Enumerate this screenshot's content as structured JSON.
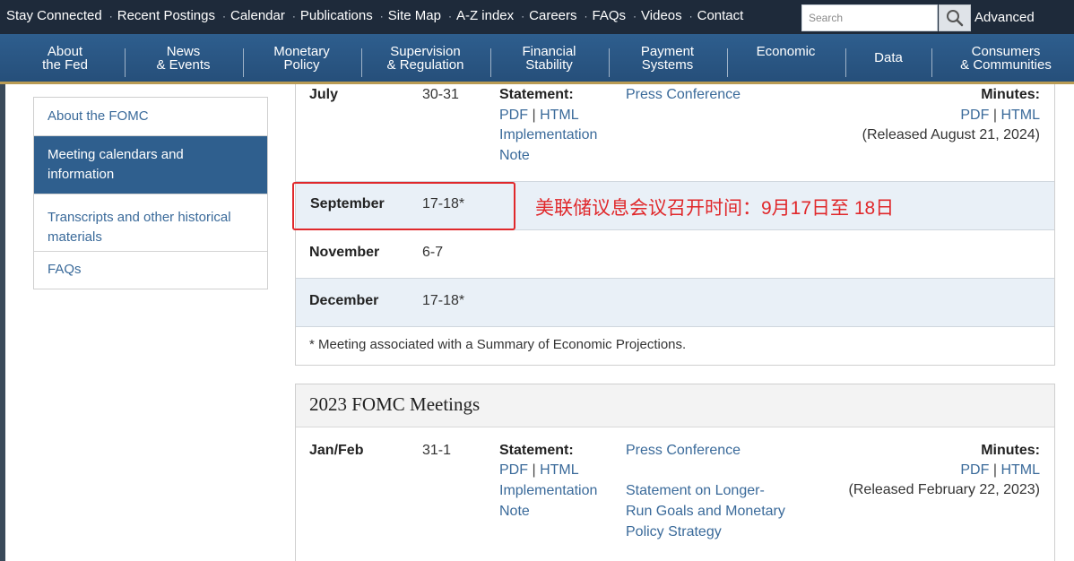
{
  "topbar": {
    "links": [
      "Stay Connected",
      "Recent Postings",
      "Calendar",
      "Publications",
      "Site Map",
      "A-Z index",
      "Careers",
      "FAQs",
      "Videos",
      "Contact"
    ],
    "search_placeholder": "Search",
    "advanced_label": "Advanced"
  },
  "nav": {
    "items": [
      {
        "line1": "About",
        "line2": "the Fed"
      },
      {
        "line1": "News",
        "line2": "& Events"
      },
      {
        "line1": "Monetary",
        "line2": "Policy"
      },
      {
        "line1": "Supervision",
        "line2": "& Regulation"
      },
      {
        "line1": "Financial",
        "line2": "Stability"
      },
      {
        "line1": "Payment",
        "line2": "Systems"
      },
      {
        "line1": "Economic",
        "line2": ""
      },
      {
        "line1": "Data",
        "line2": ""
      },
      {
        "line1": "Consumers",
        "line2": "& Communities"
      }
    ]
  },
  "sidebar": {
    "items": [
      {
        "label": "About the FOMC",
        "active": false
      },
      {
        "label": "Meeting calendars and information",
        "active": true
      },
      {
        "label": "Transcripts and other historical materials",
        "active": false
      },
      {
        "label": "FAQs",
        "active": false
      }
    ]
  },
  "meetings_2024": {
    "july": {
      "month": "July",
      "days": "30-31",
      "statement_label": "Statement:",
      "pdf": "PDF",
      "sep": "|",
      "html": "HTML",
      "impl1": "Implementation",
      "impl2": "Note",
      "press": "Press Conference",
      "minutes_label": "Minutes:",
      "released": "(Released August 21, 2024)"
    },
    "september": {
      "month": "September",
      "days": "17-18*"
    },
    "november": {
      "month": "November",
      "days": "6-7"
    },
    "december": {
      "month": "December",
      "days": "17-18*"
    },
    "footnote": "* Meeting associated with a Summary of Economic Projections."
  },
  "annotation": {
    "text": "美联储议息会议召开时间：9月17日至 18日",
    "color": "#e0282b"
  },
  "meetings_2023": {
    "title": "2023 FOMC Meetings",
    "janfeb": {
      "month": "Jan/Feb",
      "days": "31-1",
      "statement_label": "Statement:",
      "pdf": "PDF",
      "sep": "|",
      "html": "HTML",
      "impl1": "Implementation",
      "impl2": "Note",
      "press": "Press Conference",
      "longer1": "Statement on Longer-",
      "longer2": "Run Goals and Monetary",
      "longer3": "Policy Strategy",
      "minutes_label": "Minutes:",
      "released": "(Released February 22, 2023)"
    }
  },
  "colors": {
    "topbar_bg": "#1e2a3a",
    "nav_bg": "#2e5e8e",
    "link": "#3a6a9a",
    "row_alt": "#e9f0f7",
    "annotation": "#e0282b"
  }
}
